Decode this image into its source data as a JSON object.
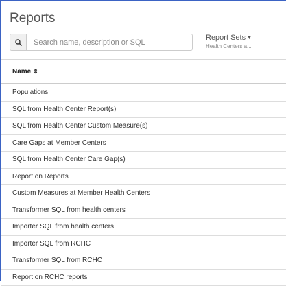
{
  "page": {
    "title": "Reports"
  },
  "search": {
    "placeholder": "Search name, description or SQL"
  },
  "report_sets": {
    "label": "Report Sets",
    "value": "Health Centers a..."
  },
  "table": {
    "column_name": "Name",
    "rows": [
      "Populations",
      "SQL from Health Center Report(s)",
      "SQL from Health Center Custom Measure(s)",
      "Care Gaps at Member Centers",
      "SQL from Health Center Care Gap(s)",
      "Report on Reports",
      "Custom Measures at Member Health Centers",
      "Transformer SQL from health centers",
      "Importer SQL from health centers",
      "Importer SQL from RCHC",
      "Transformer SQL from RCHC",
      "Report on RCHC reports"
    ]
  }
}
